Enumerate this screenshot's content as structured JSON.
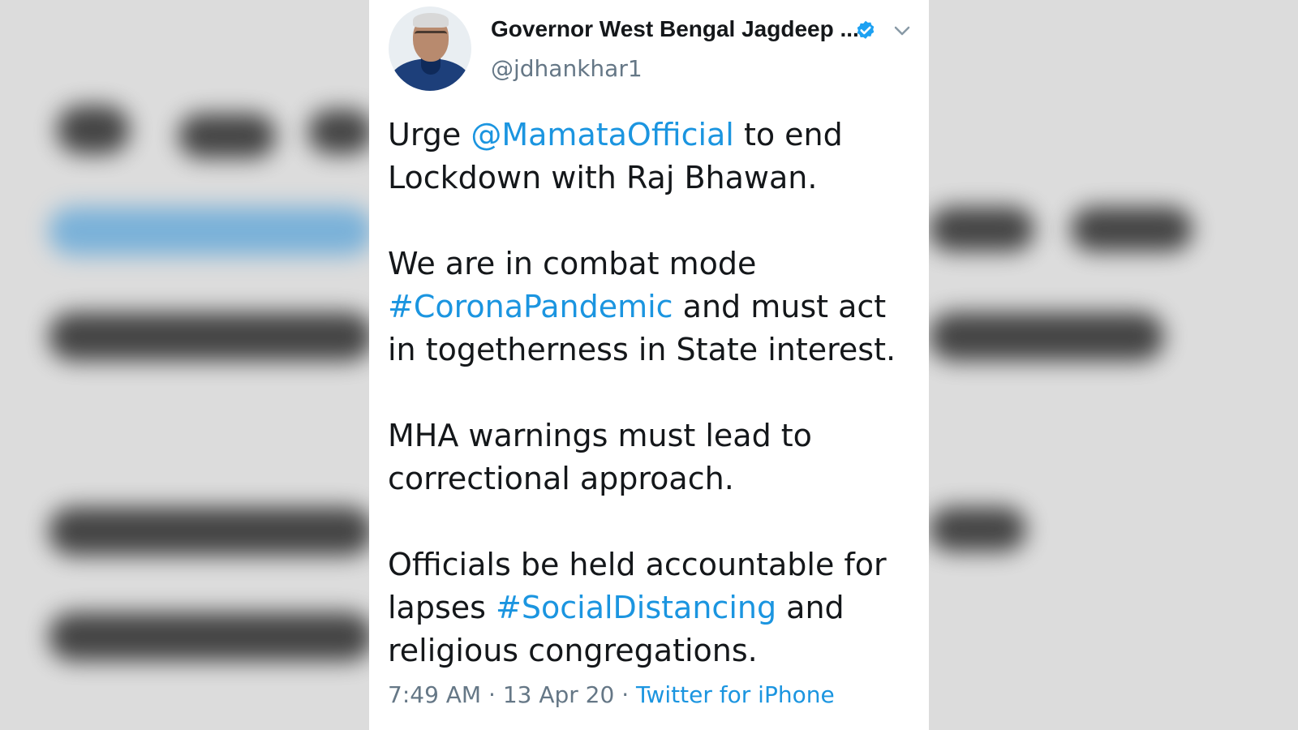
{
  "tweet": {
    "author_name": "Governor West Bengal Jagdeep ...",
    "handle": "@jdhankhar1",
    "verified_icon": "verified-badge-icon",
    "menu_icon": "chevron-down-icon",
    "paragraphs": [
      {
        "p1": "Urge ",
        "mention": "@MamataOfficial",
        "p2": " to end Lockdown with Raj Bhawan."
      },
      {
        "p1": "We are in combat mode ",
        "hashtag": "#CoronaPandemic",
        "p2": " and must act in togetherness in State interest."
      },
      {
        "text": "MHA warnings must lead to correctional approach."
      },
      {
        "p1": "Officials be held accountable for lapses ",
        "hashtag": "#SocialDistancing",
        "p2": " and religious congregations."
      }
    ],
    "time": "7:49 AM",
    "date": "13 Apr 20",
    "separator": "·",
    "source": "Twitter for iPhone"
  },
  "colors": {
    "link": "#1b95e0",
    "text": "#14171a",
    "muted": "#657786",
    "background": "#d9d9d9"
  }
}
